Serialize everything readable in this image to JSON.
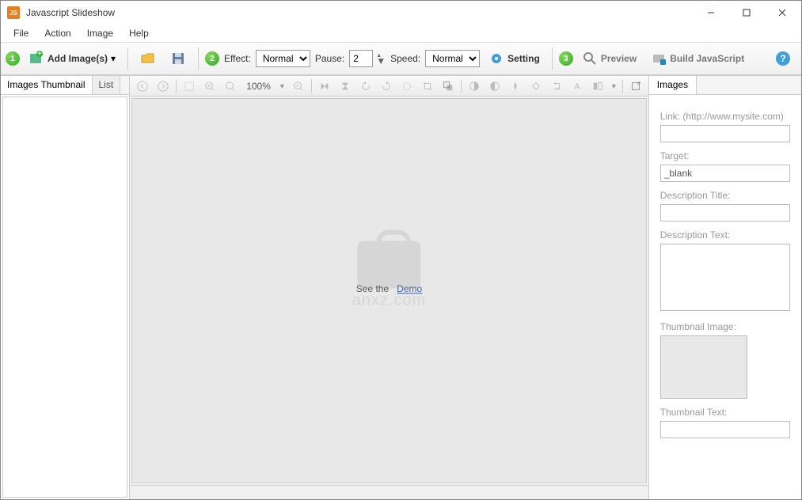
{
  "window": {
    "title": "Javascript Slideshow"
  },
  "menu": {
    "file": "File",
    "action": "Action",
    "image": "Image",
    "help": "Help"
  },
  "toolbar": {
    "add_images": "Add Image(s)",
    "effect_label": "Effect:",
    "effect_value": "Normal",
    "pause_label": "Pause:",
    "pause_value": "2",
    "speed_label": "Speed:",
    "speed_value": "Normal",
    "setting": "Setting",
    "preview": "Preview",
    "build": "Build JavaScript"
  },
  "left_tabs": {
    "thumbnail": "Images Thumbnail",
    "list": "List"
  },
  "image_toolbar": {
    "zoom": "100%"
  },
  "canvas": {
    "see_the": "See the",
    "demo": "Demo"
  },
  "watermark": {
    "text": "anxz.com"
  },
  "right": {
    "tab": "Images",
    "link_label": "Link: (http://www.mysite.com)",
    "link_value": "",
    "target_label": "Target:",
    "target_value": "_blank",
    "desc_title_label": "Description Title:",
    "desc_title_value": "",
    "desc_text_label": "Description Text:",
    "desc_text_value": "",
    "thumb_image_label": "Thumbnail Image:",
    "thumb_text_label": "Thumbnail Text:",
    "thumb_text_value": ""
  }
}
